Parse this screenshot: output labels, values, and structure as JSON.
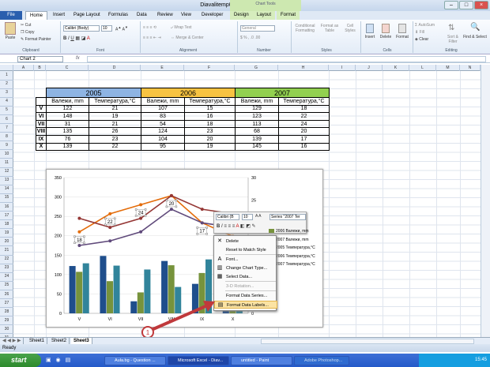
{
  "window": {
    "title": "Diavalitemp090317 - Microsoft Excel",
    "chart_tools_label": "Chart Tools"
  },
  "tabs": {
    "file": "File",
    "items": [
      "Home",
      "Insert",
      "Page Layout",
      "Formulas",
      "Data",
      "Review",
      "View",
      "Developer",
      "Design",
      "Layout",
      "Format"
    ]
  },
  "ribbon": {
    "paste": "Paste",
    "cut": "Cut",
    "copy": "Copy",
    "format_painter": "Format Painter",
    "font_name": "Calibri (Body)",
    "font_size": "10",
    "wrap_text": "Wrap Text",
    "merge_center": "Merge & Center",
    "number_format": "General",
    "cond_format": "Conditional Formatting",
    "format_table": "Format as Table",
    "cell_styles": "Cell Styles",
    "insert": "Insert",
    "delete": "Delete",
    "format": "Format",
    "autosum": "AutoSum",
    "fill": "Fill",
    "clear": "Clear",
    "sort_filter": "Sort & Filter",
    "find_select": "Find & Select",
    "groups": [
      "Clipboard",
      "Font",
      "Alignment",
      "Number",
      "Styles",
      "Cells",
      "Editing"
    ]
  },
  "formula_bar": {
    "name_box": "Chart 2",
    "fx": "fx"
  },
  "columns": [
    "A",
    "B",
    "C",
    "D",
    "E",
    "F",
    "G",
    "H",
    "I",
    "J",
    "K",
    "L",
    "M",
    "N"
  ],
  "rows": [
    "1",
    "2",
    "3",
    "4",
    "5",
    "6",
    "7",
    "8",
    "9",
    "10",
    "11",
    "12",
    "13",
    "14",
    "15",
    "16",
    "17",
    "18",
    "19",
    "20",
    "21",
    "22",
    "23",
    "24",
    "25",
    "26",
    "27",
    "28",
    "29",
    "30",
    "31"
  ],
  "table": {
    "years": [
      "2005",
      "2006",
      "2007"
    ],
    "headers": [
      "Валежи, mm",
      "Температура,°C",
      "Валежи, mm",
      "Температура,°C",
      "Валежи, mm",
      "Температура,°C"
    ],
    "rows": [
      [
        "V",
        "122",
        "21",
        "107",
        "15",
        "129",
        "18"
      ],
      [
        "VI",
        "148",
        "19",
        "83",
        "16",
        "123",
        "22"
      ],
      [
        "VII",
        "31",
        "21",
        "54",
        "18",
        "113",
        "24"
      ],
      [
        "VIII",
        "135",
        "26",
        "124",
        "23",
        "68",
        "20"
      ],
      [
        "IX",
        "76",
        "23",
        "104",
        "20",
        "139",
        "17"
      ],
      [
        "X",
        "139",
        "22",
        "95",
        "19",
        "145",
        "16"
      ]
    ]
  },
  "chart_data": {
    "type": "bar",
    "categories": [
      "V",
      "VI",
      "VII",
      "VIII",
      "IX",
      "X"
    ],
    "ylim": [
      0,
      350
    ],
    "y_ticks": [
      "0",
      "50",
      "100",
      "150",
      "200",
      "250",
      "300",
      "350"
    ],
    "y2_ticks": [
      "0",
      "5",
      "10",
      "15",
      "20",
      "25",
      "30"
    ],
    "series": [
      {
        "name": "2005 Валежи, mm",
        "kind": "bar",
        "color": "#1f4e8c",
        "values": [
          122,
          148,
          31,
          135,
          76,
          139
        ]
      },
      {
        "name": "2006 Валежи, mm",
        "kind": "bar",
        "color": "#77933c",
        "values": [
          107,
          83,
          54,
          124,
          104,
          95
        ]
      },
      {
        "name": "2007 Валежи, mm",
        "kind": "bar",
        "color": "#31849b",
        "values": [
          129,
          123,
          113,
          68,
          139,
          145
        ]
      },
      {
        "name": "2005 Температура,°C",
        "kind": "line",
        "color": "#e46c0a",
        "values": [
          18,
          22,
          24,
          26,
          20,
          17
        ]
      },
      {
        "name": "2006 Температура,°C",
        "kind": "line",
        "color": "#953735",
        "values": [
          21,
          19,
          21,
          26,
          23,
          22
        ]
      },
      {
        "name": "2007 Температура,°C",
        "kind": "line",
        "color": "#604a7b",
        "values": [
          15,
          16,
          18,
          23,
          20,
          19
        ]
      }
    ],
    "data_labels": [
      "18",
      "22",
      "24",
      "20",
      "17"
    ]
  },
  "context_menu": {
    "items": [
      "Delete",
      "Reset to Match Style",
      "Font...",
      "Change Chart Type...",
      "Select Data...",
      "3-D Rotation...",
      "Format Data Series...",
      "Format Data Labels..."
    ]
  },
  "mini_toolbar": {
    "font": "Calibri (B",
    "size": "10",
    "series": "Series \"2007 Ter"
  },
  "legend_visible": [
    "2006 Валежи, mm",
    "2007 Валежи, mm",
    "2005 Температура,°C",
    "2006 Температура,°C",
    "2007 Температура,°C"
  ],
  "callout": "1",
  "sheets": [
    "Sheet1",
    "Sheet2",
    "Sheet3"
  ],
  "status": "Ready",
  "taskbar": {
    "start": "start",
    "tasks": [
      "Aula.bg - Question ...",
      "Microsoft Excel - Diav...",
      "untitled - Paint",
      "Adobe Photoshop..."
    ],
    "clock": "15:45"
  }
}
